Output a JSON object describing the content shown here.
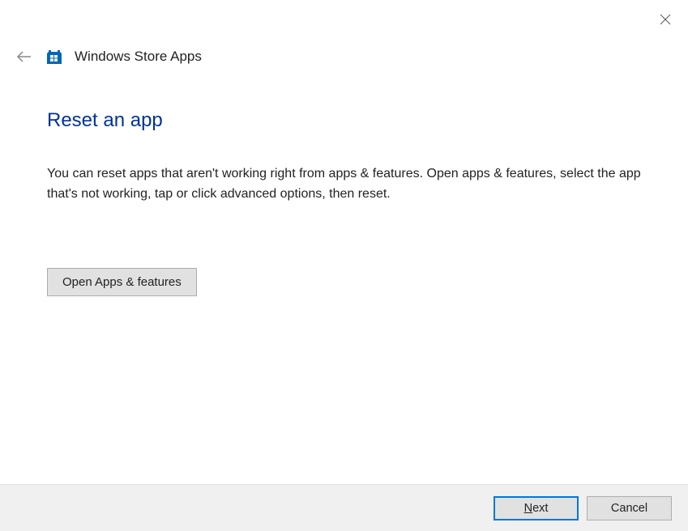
{
  "header": {
    "title": "Windows Store Apps"
  },
  "main": {
    "page_title": "Reset an app",
    "description": "You can reset apps that aren't working right from apps & features. Open apps & features, select the app that's not working, tap or click advanced options, then reset.",
    "open_button_label": "Open Apps & features"
  },
  "footer": {
    "next_mnemonic": "N",
    "next_rest": "ext",
    "cancel_label": "Cancel"
  }
}
